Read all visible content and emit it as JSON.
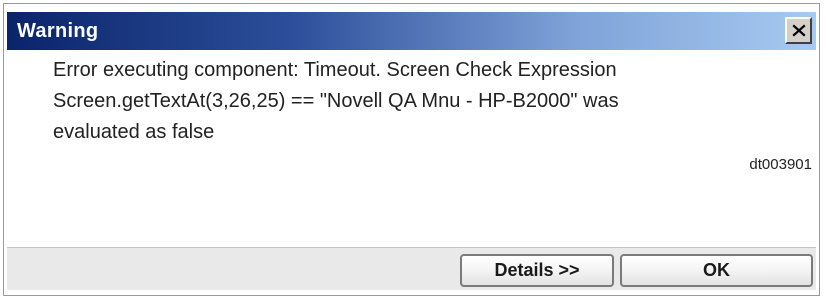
{
  "window": {
    "title": "Warning",
    "close_icon": "close-icon"
  },
  "message": {
    "line1": "Error executing component: Timeout. Screen Check Expression",
    "line2": "Screen.getTextAt(3,26,25) == \"Novell QA Mnu - HP-B2000\" was",
    "line3": "evaluated as false",
    "code": "dt003901"
  },
  "buttons": {
    "details_label": "Details >>",
    "ok_label": "OK"
  },
  "colors": {
    "titlebar_start": "#0a246a",
    "titlebar_end": "#a6caf0"
  }
}
